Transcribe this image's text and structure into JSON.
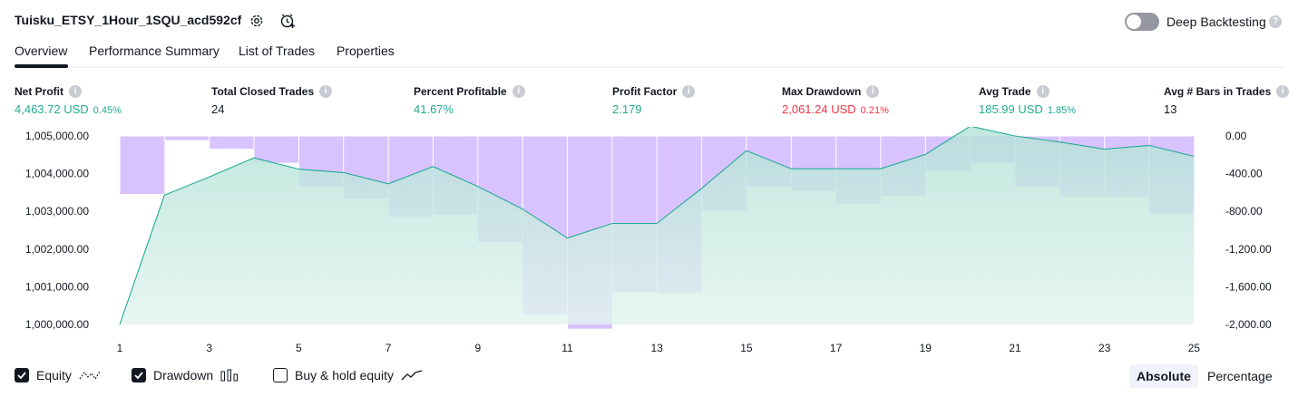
{
  "header": {
    "strategy_title": "Tuisku_ETSY_1Hour_1SQU_acd592cf",
    "deep_backtesting_label": "Deep Backtesting",
    "deep_backtesting_enabled": false
  },
  "tabs": [
    {
      "label": "Overview",
      "active": true
    },
    {
      "label": "Performance Summary",
      "active": false
    },
    {
      "label": "List of Trades",
      "active": false
    },
    {
      "label": "Properties",
      "active": false
    }
  ],
  "metrics": [
    {
      "label": "Net Profit",
      "value": "4,463.72 USD",
      "pct": "0.45%",
      "color": "#22ab94"
    },
    {
      "label": "Total Closed Trades",
      "value": "24",
      "pct": "",
      "color": "#131722"
    },
    {
      "label": "Percent Profitable",
      "value": "41.67%",
      "pct": "",
      "color": "#22ab94"
    },
    {
      "label": "Profit Factor",
      "value": "2.179",
      "pct": "",
      "color": "#22ab94"
    },
    {
      "label": "Max Drawdown",
      "value": "2,061.24 USD",
      "pct": "0.21%",
      "color": "#f23645"
    },
    {
      "label": "Avg Trade",
      "value": "185.99 USD",
      "pct": "1.85%",
      "color": "#22ab94"
    },
    {
      "label": "Avg # Bars in Trades",
      "value": "13",
      "pct": "",
      "color": "#131722"
    }
  ],
  "chart_data": {
    "type": "area",
    "x_tick_labels": [
      "1",
      "3",
      "5",
      "7",
      "9",
      "11",
      "13",
      "15",
      "17",
      "19",
      "21",
      "23",
      "25"
    ],
    "left_axis": {
      "tick_labels": [
        "1,005,000.00",
        "1,004,000.00",
        "1,003,000.00",
        "1,002,000.00",
        "1,001,000.00",
        "1,000,000.00"
      ],
      "ylim": [
        1000000,
        1005000
      ]
    },
    "right_axis": {
      "tick_labels": [
        "0.00",
        "-400.00",
        "-800.00",
        "-1,200.00",
        "-1,600.00",
        "-2,000.00"
      ],
      "ylim": [
        -2000,
        0
      ]
    },
    "series": [
      {
        "name": "Equity",
        "kind": "area",
        "color": "#22ab94",
        "x": [
          1,
          2,
          3,
          4,
          5,
          6,
          7,
          8,
          9,
          10,
          11,
          12,
          13,
          14,
          15,
          16,
          17,
          18,
          19,
          20,
          21,
          22,
          23,
          24,
          25
        ],
        "values": [
          1000000,
          1003430,
          1003910,
          1004420,
          1004120,
          1004030,
          1003730,
          1004190,
          1003660,
          1003060,
          1002290,
          1002680,
          1002680,
          1003610,
          1004610,
          1004130,
          1004130,
          1004130,
          1004510,
          1005260,
          1005000,
          1004840,
          1004650,
          1004750,
          1004460
        ]
      },
      {
        "name": "Drawdown",
        "kind": "bar",
        "color": "#b388ff",
        "x": [
          1,
          2,
          3,
          4,
          5,
          6,
          7,
          8,
          9,
          10,
          11,
          12,
          13,
          14,
          15,
          16,
          17,
          18,
          19,
          20,
          21,
          22,
          23,
          24,
          25
        ],
        "values": [
          -10,
          -620,
          -50,
          -140,
          -290,
          -540,
          -670,
          -860,
          -840,
          -1130,
          -1900,
          -2050,
          -1660,
          -1670,
          -800,
          -540,
          -590,
          -720,
          -640,
          -370,
          -290,
          -540,
          -650,
          -650,
          -830
        ]
      }
    ]
  },
  "legend": {
    "equity_label": "Equity",
    "drawdown_label": "Drawdown",
    "buy_hold_label": "Buy & hold equity",
    "equity_checked": true,
    "drawdown_checked": true,
    "buy_hold_checked": false
  },
  "view_toggle": {
    "absolute_label": "Absolute",
    "percentage_label": "Percentage",
    "selected": "Absolute"
  }
}
